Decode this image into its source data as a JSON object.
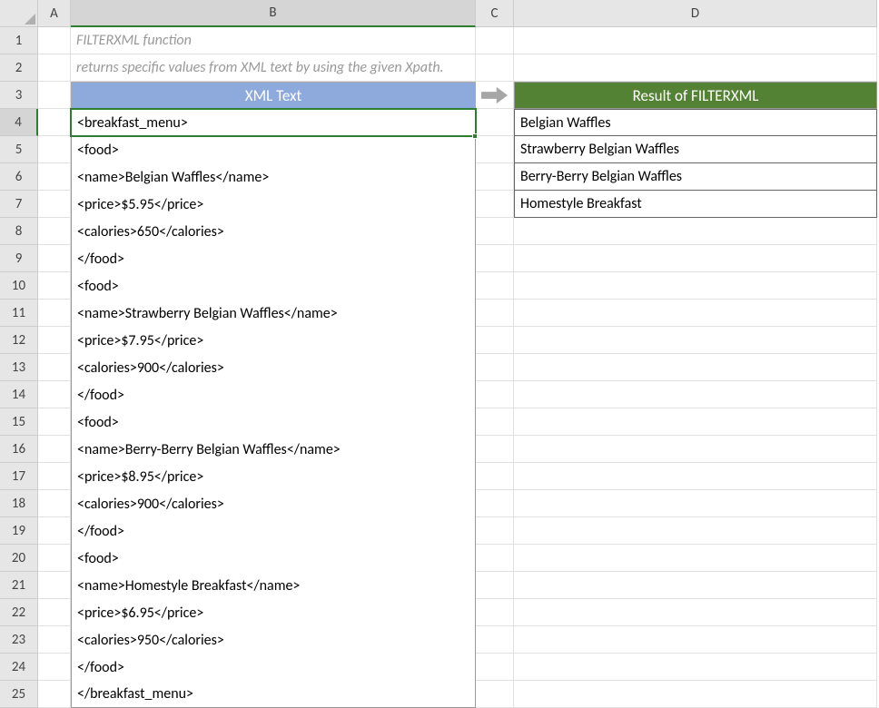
{
  "columns": [
    "A",
    "B",
    "C",
    "D"
  ],
  "rows": [
    "1",
    "2",
    "3",
    "4",
    "5",
    "6",
    "7",
    "8",
    "9",
    "10",
    "11",
    "12",
    "13",
    "14",
    "15",
    "16",
    "17",
    "18",
    "19",
    "20",
    "21",
    "22",
    "23",
    "24",
    "25"
  ],
  "notes": {
    "line1": "FILTERXML function",
    "line2": "returns specific values from XML text by using the given Xpath."
  },
  "headers": {
    "xml": "XML Text",
    "result": "Result of FILTERXML"
  },
  "xml_lines": [
    "<breakfast_menu>",
    "<food>",
    "<name>Belgian Waffles</name>",
    "<price>$5.95</price>",
    "<calories>650</calories>",
    "</food>",
    "<food>",
    "<name>Strawberry Belgian Waffles</name>",
    "<price>$7.95</price>",
    "<calories>900</calories>",
    "</food>",
    "<food>",
    "<name>Berry-Berry Belgian Waffles</name>",
    "<price>$8.95</price>",
    "<calories>900</calories>",
    "</food>",
    "<food>",
    "<name>Homestyle Breakfast</name>",
    "<price>$6.95</price>",
    "<calories>950</calories>",
    "</food>",
    "</breakfast_menu>"
  ],
  "results": [
    "Belgian Waffles",
    "Strawberry Belgian Waffles",
    "Berry-Berry Belgian Waffles",
    "Homestyle Breakfast"
  ],
  "selected_cell": "B4",
  "active_row": "4",
  "active_col": "B"
}
